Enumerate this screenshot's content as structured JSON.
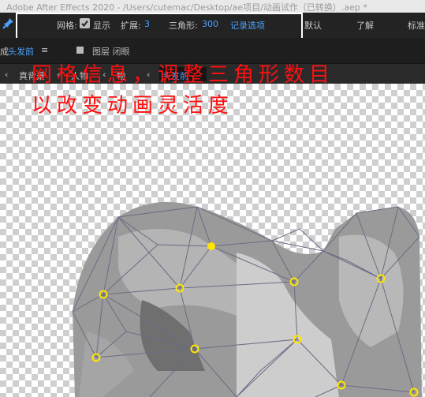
{
  "window": {
    "title": "Adobe After Effects 2020 - /Users/cutemac/Desktop/ae项目/动画试作（已转换）.aep *"
  },
  "toolbar": {
    "mesh_label": "网格:",
    "show_label": "显示",
    "expand_label": "扩展:",
    "expand_value": "3",
    "triangles_label": "三角形:",
    "triangles_value": "300",
    "record_label": "记录选项",
    "workspace_default": "默认",
    "workspace_learn": "了解",
    "workspace_standard": "标准"
  },
  "layer_bar": {
    "prefix": "成",
    "comp_name": "头发前",
    "menu_glyph": "≡",
    "layer_label": "图层 闭眼"
  },
  "breadcrumbs": [
    "真背景",
    "人物",
    "物",
    "头发前"
  ],
  "annotation": {
    "line1": "网格信息，调整三角形数目",
    "line2": "以改变动画灵活度"
  },
  "colors": {
    "accent": "#4aa3ff",
    "annotation": "#ff1010",
    "pin_point": "#ffe600",
    "mesh": "#6b6b85"
  },
  "icons": {
    "pin": "pin-icon",
    "check": "check-icon",
    "back": "back-arrow-icon"
  }
}
